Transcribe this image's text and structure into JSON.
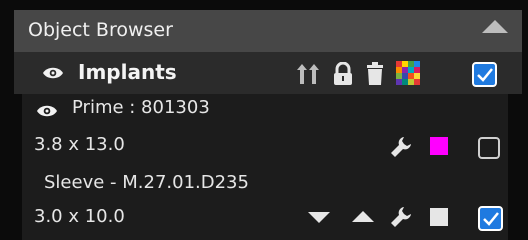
{
  "panel": {
    "title": "Object Browser",
    "group": {
      "label": "Implants",
      "checked": true
    },
    "items": [
      {
        "name": "Prime : 801303",
        "size": "3.8 x 13.0",
        "color": "#ff00ff",
        "checked": false
      },
      {
        "name": "Sleeve - M.27.01.D235",
        "size": "3.0 x 10.0",
        "color": "#e6e6e6",
        "checked": true
      }
    ]
  }
}
